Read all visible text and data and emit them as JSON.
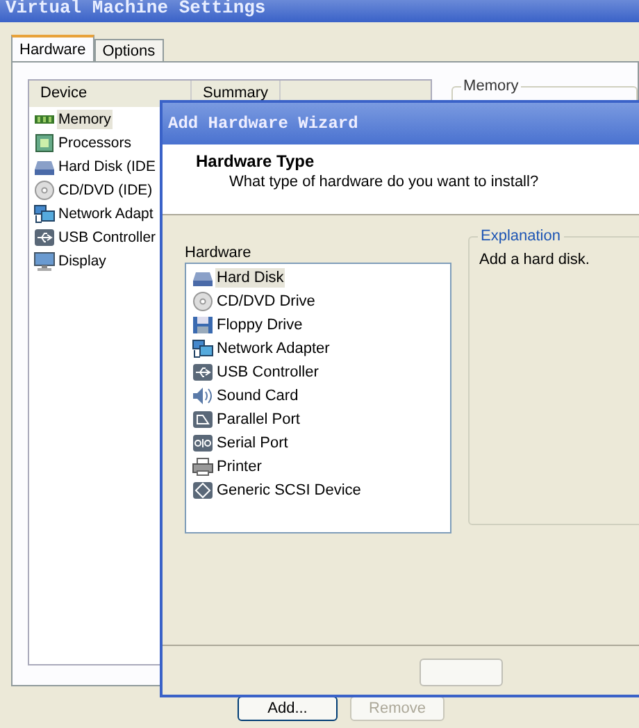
{
  "window": {
    "title": "Virtual Machine Settings"
  },
  "tabs": [
    {
      "label": "Hardware",
      "selected": true
    },
    {
      "label": "Options",
      "selected": false
    }
  ],
  "device_table": {
    "columns": [
      "Device",
      "Summary"
    ],
    "rows": [
      {
        "name": "Memory",
        "kind": "memory",
        "selected": true
      },
      {
        "name": "Processors",
        "kind": "processor",
        "selected": false
      },
      {
        "name": "Hard Disk (IDE",
        "kind": "disk",
        "selected": false
      },
      {
        "name": "CD/DVD (IDE)",
        "kind": "cd",
        "selected": false
      },
      {
        "name": "Network Adapt",
        "kind": "network",
        "selected": false
      },
      {
        "name": "USB Controller",
        "kind": "usb",
        "selected": false
      },
      {
        "name": "Display",
        "kind": "display",
        "selected": false
      }
    ]
  },
  "memory_group": {
    "title": "Memory"
  },
  "buttons": [
    {
      "label": "Add...",
      "disabled": false
    },
    {
      "label": "Remove",
      "disabled": true
    }
  ],
  "wizard": {
    "title": "Add Hardware Wizard",
    "heading": "Hardware Type",
    "subtitle": "What type of hardware do you want to install?",
    "list_label": "Hardware",
    "items": [
      {
        "name": "Hard Disk",
        "kind": "disk",
        "selected": true
      },
      {
        "name": "CD/DVD Drive",
        "kind": "cd",
        "selected": false
      },
      {
        "name": "Floppy Drive",
        "kind": "floppy",
        "selected": false
      },
      {
        "name": "Network Adapter",
        "kind": "network",
        "selected": false
      },
      {
        "name": "USB Controller",
        "kind": "usb",
        "selected": false
      },
      {
        "name": "Sound Card",
        "kind": "sound",
        "selected": false
      },
      {
        "name": "Parallel Port",
        "kind": "parallel",
        "selected": false
      },
      {
        "name": "Serial Port",
        "kind": "serial",
        "selected": false
      },
      {
        "name": "Printer",
        "kind": "printer",
        "selected": false
      },
      {
        "name": "Generic SCSI Device",
        "kind": "scsi",
        "selected": false
      }
    ],
    "explanation": {
      "title": "Explanation",
      "text": "Add a hard disk."
    }
  }
}
